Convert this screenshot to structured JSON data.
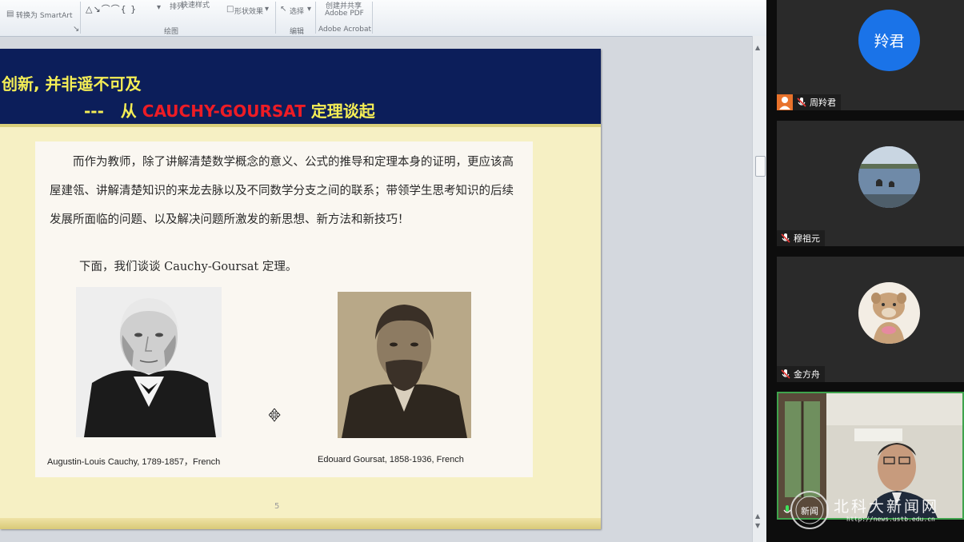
{
  "ribbon": {
    "convert_smartart": "转换为 SmartArt",
    "arrange": "排列",
    "quick_styles": "快速样式",
    "shape_effects": "形状效果",
    "select": "选择",
    "create_share_pdf_line1": "创建并共享",
    "create_share_pdf_line2": "Adobe PDF",
    "group_drawing": "绘图",
    "group_editing": "编辑",
    "group_acrobat": "Adobe Acrobat"
  },
  "slide": {
    "title_line1": "创新, 并非遥不可及",
    "title_line2_prefix": "---   从 ",
    "title_line2_red": "CAUCHY-GOURSAT",
    "title_line2_suffix": " 定理谈起",
    "paragraph": "而作为教师，除了讲解清楚数学概念的意义、公式的推导和定理本身的证明，更应该高屋建瓴、讲解清楚知识的来龙去脉以及不同数学分支之间的联系；带领学生思考知识的后续发展所面临的问题、以及解决问题所激发的新思想、新方法和新技巧！",
    "paragraph2": "下面，我们谈谈 Cauchy-Goursat 定理。",
    "caption_cauchy": "Augustin-Louis Cauchy, 1789-1857，French",
    "caption_goursat": "Edouard   Goursat, 1858-1936, French",
    "page_number": "5"
  },
  "participants": [
    {
      "name": "周羚君",
      "avatar_text": "羚君",
      "avatar_color": "#1a73e8"
    },
    {
      "name": "穆祖元"
    },
    {
      "name": "金方舟"
    },
    {
      "name": ""
    }
  ],
  "watermark": {
    "seal_text": "新闻",
    "site_name": "北科大新闻网",
    "url": "http://news.ustb.edu.cn"
  }
}
